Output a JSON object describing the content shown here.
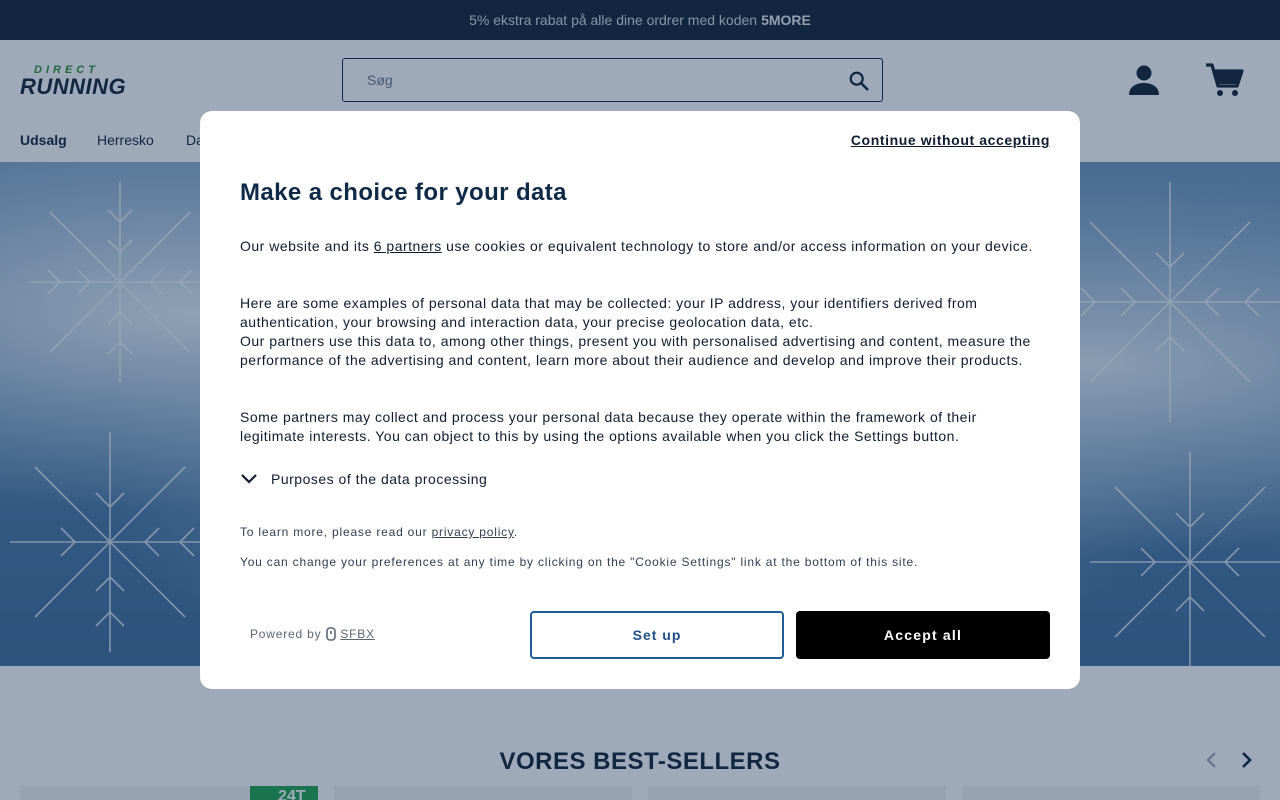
{
  "promo": {
    "text": "5% ekstra rabat på alle dine ordrer med koden",
    "code": "5MORE"
  },
  "header": {
    "logo_small": "DIRECT",
    "logo_big": "RUNNING",
    "search_placeholder": "Søg"
  },
  "nav": {
    "items": [
      "Udsalg",
      "Herresko",
      "Da"
    ]
  },
  "bestsellers": {
    "title": "VORES BEST-SELLERS",
    "badge": "24T"
  },
  "consent": {
    "continue_without": "Continue without accepting",
    "title": "Make a choice for your data",
    "p1_before": "Our website and its ",
    "p1_link": "6 partners",
    "p1_after": " use cookies or equivalent technology to store and/or access information on your device.",
    "p2": "Here are some examples of personal data that may be collected: your IP address, your identifiers derived from authentication, your browsing and interaction data, your precise geolocation data, etc.",
    "p3": "Our partners use this data to, among other things, present you with personalised advertising and content, measure the performance of the advertising and content, learn more about their audience and develop and improve their products.",
    "p4": "Some partners may collect and process your personal data because they operate within the framework of their legitimate interests. You can object to this by using the options available when you click the Settings button.",
    "purposes": "Purposes of the data processing",
    "learn_before": "To learn more, please read our ",
    "learn_link": "privacy policy",
    "learn_after": ".",
    "change_prefs": "You can change your preferences at any time by clicking on the \"Cookie Settings\" link at the bottom of this site.",
    "powered_by": "Powered by",
    "powered_brand": "SFBX",
    "setup_button": "Set up",
    "accept_button": "Accept all"
  },
  "colors": {
    "navy": "#0e1c2e",
    "accent_green": "#2a8f2a",
    "badge_green": "#1ea34a",
    "setup_border": "#1f5c99"
  }
}
